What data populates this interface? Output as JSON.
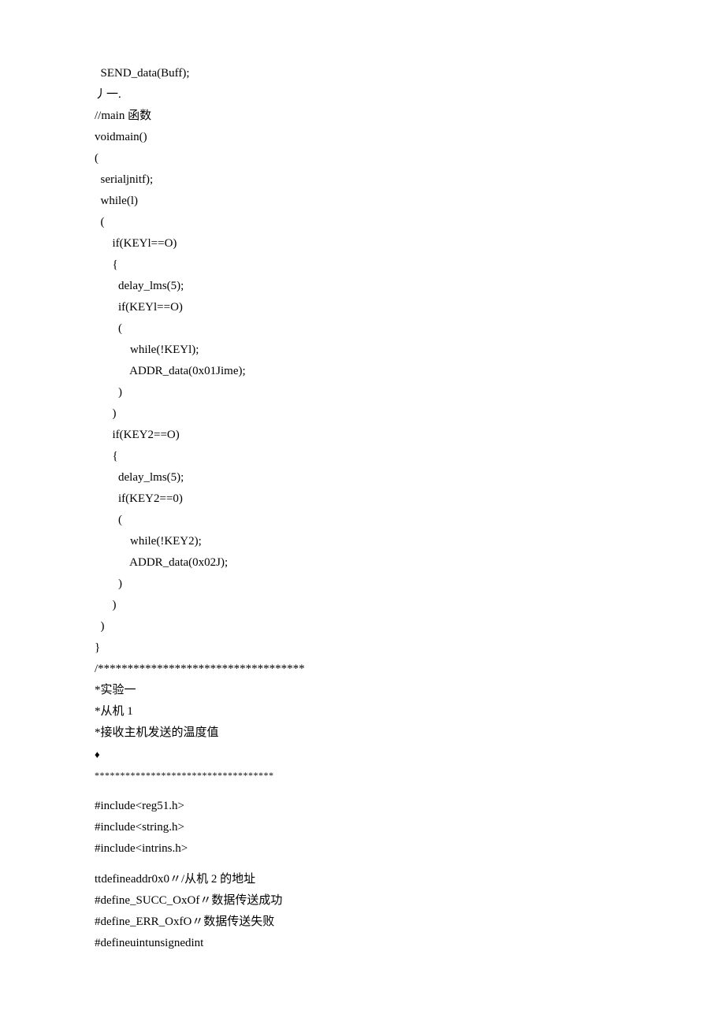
{
  "lines": {
    "l1": "  SEND_data(Buff);",
    "l2": "丿一.",
    "l3": "//main 函数",
    "l4": "voidmain()",
    "l5": "(",
    "l6": "  serialjnitf);",
    "l7": "  while(l)",
    "l8": "  (",
    "l9": "      if(KEYl==O)",
    "l10": "      {",
    "l11": "        delay_lms(5);",
    "l12": "        if(KEYl==O)",
    "l13": "        (",
    "l14": "            while(!KEYl);",
    "l15": "            ADDR_data(0x01Jime);",
    "l16": "        )",
    "l17": "      )",
    "l18": "      if(KEY2==O)",
    "l19": "      {",
    "l20": "        delay_lms(5);",
    "l21": "        if(KEY2==0)",
    "l22": "        (",
    "l23": "            while(!KEY2);",
    "l24": "            ADDR_data(0x02J);",
    "l25": "        )",
    "l26": "      )",
    "l27": "  )",
    "l28": "}",
    "l29": "/***********************************",
    "l30": "*实验一",
    "l31": "*从机 1",
    "l32": "*接收主机发送的温度值",
    "l33": "♦",
    "l34": "***********************************",
    "l35": "#include<reg51.h>",
    "l36": "#include<string.h>",
    "l37": "#include<intrins.h>",
    "l38": "ttdefineaddr0x0〃/从机 2 的地址",
    "l39": "#define_SUCC_OxOf〃数据传送成功",
    "l40": "#define_ERR_OxfO〃数据传送失败",
    "l41": "#defineuintunsignedint"
  }
}
